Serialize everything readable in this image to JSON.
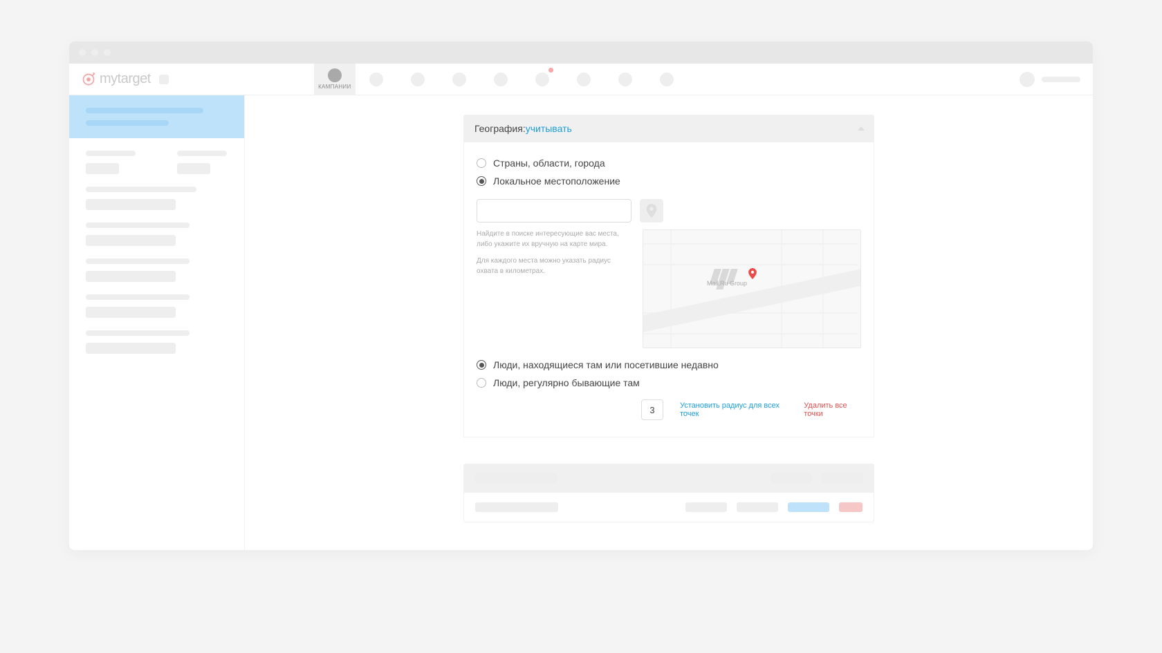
{
  "brand": "mytarget",
  "nav": {
    "active_tab_label": "КАМПАНИИ"
  },
  "geography": {
    "title_prefix": "География: ",
    "title_link": "учитывать",
    "mode_options": {
      "countries": "Страны, области, города",
      "local": "Локальное местоположение"
    },
    "selected_mode": "local",
    "help1": "Найдите в поиске интересующие вас места, либо укажите их вручную на карте мира.",
    "help2": "Для каждого места можно указать радиус охвата в километрах.",
    "map_label": "Mail.Ru Group",
    "audience_options": {
      "present": "Люди, находящиеся там или посетившие недавно",
      "regular": "Люди, регулярно бывающие там"
    },
    "selected_audience": "present",
    "radius_value": "3",
    "actions": {
      "set_radius_all": "Установить радиус для всех точек",
      "delete_all": "Удалить все точки"
    }
  }
}
